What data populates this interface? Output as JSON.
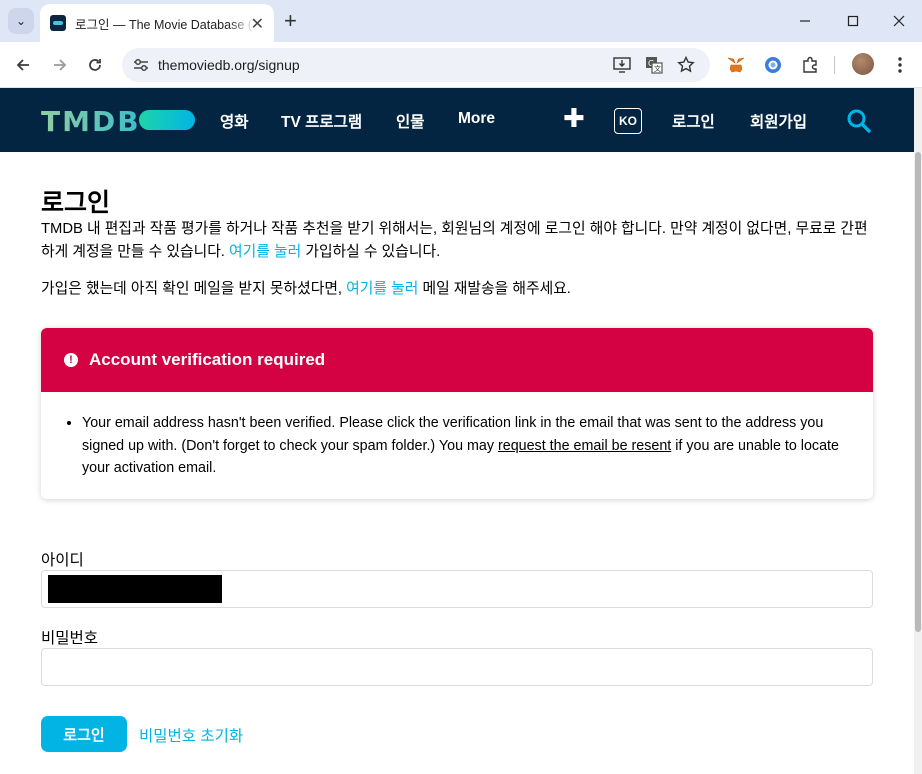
{
  "browser": {
    "tab_title": "로그인 — The Movie Database (TMDB)",
    "url": "themoviedb.org/signup",
    "dropdown_glyph": "⌄",
    "new_tab_glyph": "+",
    "close_glyph": "✕"
  },
  "header": {
    "logo": "TMDB",
    "nav": [
      "영화",
      "TV 프로그램",
      "인물",
      "More"
    ],
    "lang": "KO",
    "login": "로그인",
    "signup": "회원가입",
    "colors": {
      "background": "#032541",
      "accent": "#01b4e4"
    }
  },
  "content": {
    "title": "로그인",
    "intro_before": "TMDB 내 편집과 작품 평가를 하거나 작품 추천을 받기 위해서는, 회원님의 계정에 로그인 해야 합니다. 만약 계정이 없다면, 무료로 간편하게 계정을 만들 수 있습니다. ",
    "intro_link": "여기를 눌러",
    "intro_after": " 가입하실 수 있습니다.",
    "resend_before": "가입은 했는데 아직 확인 메일을 받지 못하셨다면, ",
    "resend_link": "여기를 눌러",
    "resend_after": " 메일 재발송을 해주세요."
  },
  "alert": {
    "title": "Account verification required",
    "body_before": "Your email address hasn't been verified. Please click the verification link in the email that was sent to the address you signed up with. (Don't forget to check your spam folder.) You may ",
    "body_link": "request the email be resent",
    "body_after": " if you are unable to locate your activation email.",
    "color": "#d40242"
  },
  "form": {
    "username_label": "아이디",
    "password_label": "비밀번호",
    "login_button": "로그인",
    "reset_link": "비밀번호 초기화"
  }
}
